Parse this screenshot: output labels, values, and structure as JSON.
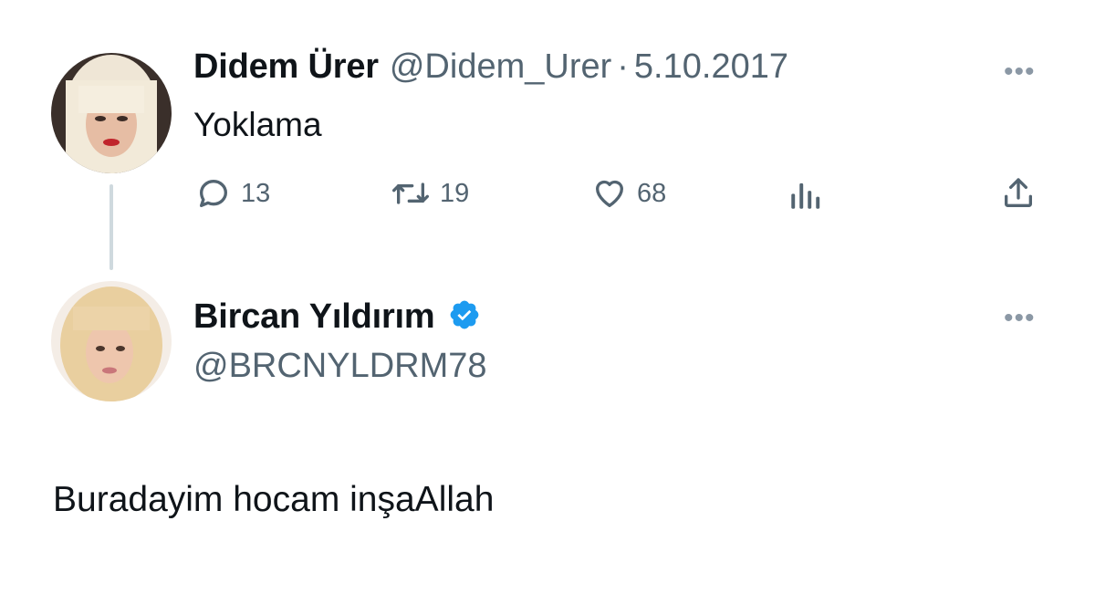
{
  "tweet": {
    "author_name": "Didem Ürer",
    "handle": "@Didem_Urer",
    "separator": "·",
    "date": "5.10.2017",
    "text": "Yoklama",
    "actions": {
      "replies": "13",
      "retweets": "19",
      "likes": "68"
    },
    "more_label": "•••"
  },
  "reply": {
    "author_name": "Bircan Yıldırım",
    "handle": "@BRCNYLDRM78",
    "verified": true,
    "text": "Buradayim hocam inşaAllah",
    "more_label": "•••"
  },
  "colors": {
    "text_primary": "#0f1419",
    "text_secondary": "#536471",
    "verified_blue": "#1d9bf0",
    "thread_line": "#cfd9de"
  },
  "icons": [
    "reply-icon",
    "retweet-icon",
    "like-icon",
    "views-icon",
    "share-icon",
    "verified-badge-icon",
    "more-icon"
  ]
}
